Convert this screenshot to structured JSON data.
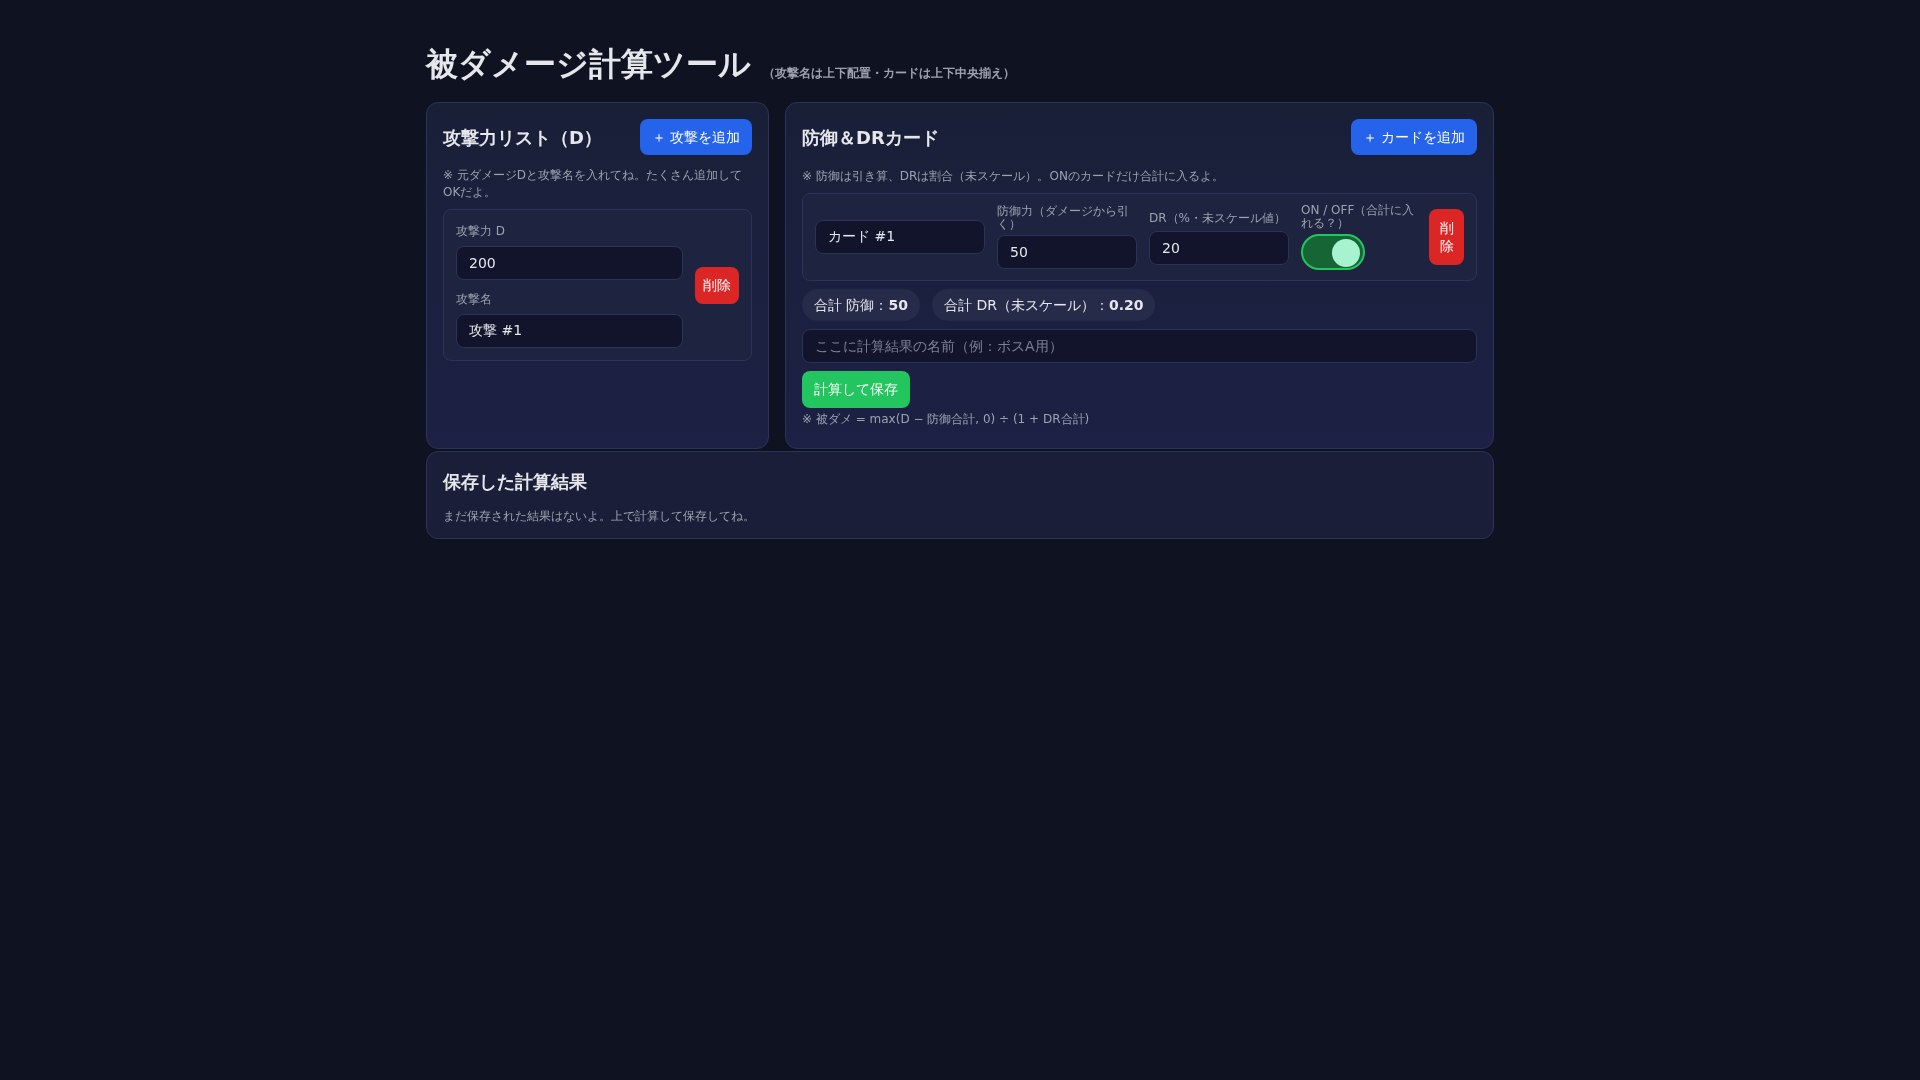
{
  "header": {
    "title": "被ダメージ計算ツール",
    "subtitle": "（攻撃名は上下配置・カードは上下中央揃え）"
  },
  "attack_panel": {
    "title": "攻撃力リスト（D）",
    "add_button": "＋ 攻撃を追加",
    "note": "※ 元ダメージDと攻撃名を入れてね。たくさん追加してOKだよ。",
    "attacks": [
      {
        "power_label": "攻撃力 D",
        "power": "200",
        "name_label": "攻撃名",
        "name": "攻撃 #1",
        "delete_button": "削除"
      }
    ]
  },
  "defense_panel": {
    "title": "防御＆DRカード",
    "add_button": "＋ カードを追加",
    "note": "※ 防御は引き算、DRは割合（未スケール）。ONのカードだけ合計に入るよ。",
    "cards": [
      {
        "name": "カード #1",
        "defense_label": "防御力（ダメージから引く）",
        "defense": "50",
        "dr_label": "DR（%・未スケール値）",
        "dr": "20",
        "toggle_label": "ON / OFF（合計に入れる？）",
        "on": true,
        "delete_button": "削除"
      }
    ],
    "totals": [
      "合計 防御：**50**",
      "合計 DR（未スケール）：**0.20**"
    ],
    "result_name": {
      "placeholder": "ここに計算結果の名前（例：ボスA用）"
    },
    "save_button": "計算して保存",
    "formula": "※ 被ダメ = max(D − 防御合計, 0) ÷ (1 + DR合計)"
  },
  "saved_panel": {
    "title": "保存した計算結果",
    "empty_message": "まだ保存された結果はないよ。上で計算して保存してね。"
  }
}
